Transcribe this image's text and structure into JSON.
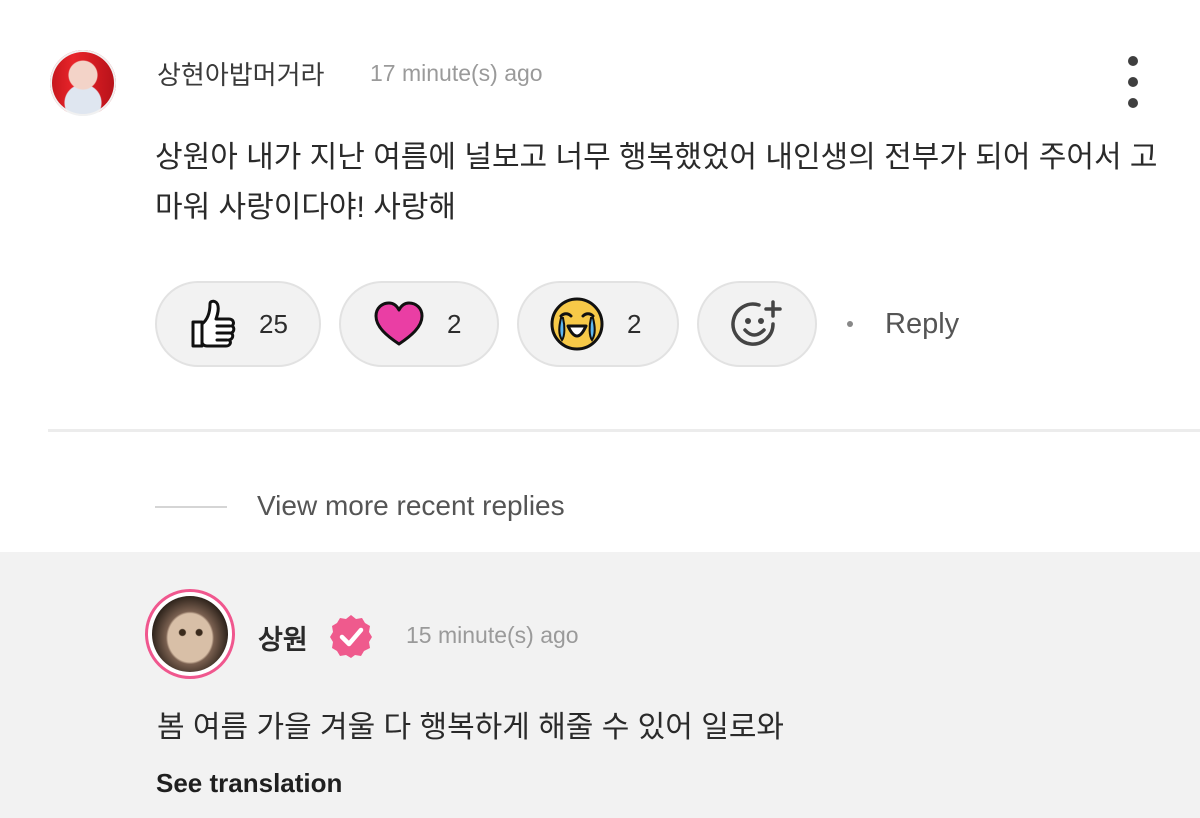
{
  "comment": {
    "author": "상현아밥머거라",
    "time": "17 minute(s) ago",
    "text": "상원아 내가 지난 여름에 널보고 너무 행복했었어 내인생의 전부가 되어 주어서 고마워 사랑이다야! 사랑해",
    "reactions": [
      {
        "icon": "thumbs-up-icon",
        "count": "25"
      },
      {
        "icon": "heart-icon",
        "count": "2"
      },
      {
        "icon": "crying-face-icon",
        "count": "2"
      }
    ],
    "reply_label": "Reply"
  },
  "view_more_replies": "View more recent replies",
  "reply": {
    "author": "상원",
    "time": "15 minute(s) ago",
    "text": "봄 여름 가을 겨울 다 행복하게 해줄 수 있어 일로와",
    "see_translation": "See translation"
  },
  "colors": {
    "accent_pink": "#ef5a8d",
    "heart": "#ea3ea4",
    "emoji_yellow": "#f7c948",
    "reply_bg": "#f2f2f2"
  }
}
